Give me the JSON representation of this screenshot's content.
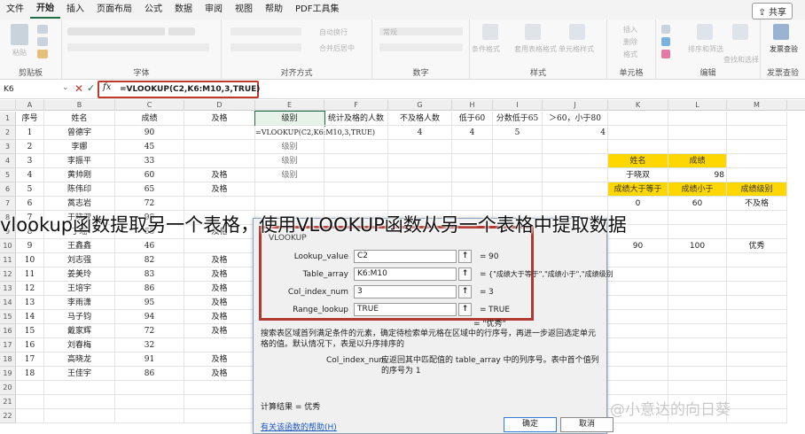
{
  "menu": {
    "items": [
      "文件",
      "开始",
      "插入",
      "页面布局",
      "公式",
      "数据",
      "审阅",
      "视图",
      "帮助",
      "PDF工具集"
    ],
    "active_index": 1,
    "share_label": "共享"
  },
  "ribbon": {
    "groups": [
      "剪贴板",
      "字体",
      "对齐方式",
      "数字",
      "样式",
      "单元格",
      "编辑",
      "发票查验"
    ],
    "paste_label": "粘贴",
    "wrap_text_label": "自动换行",
    "merge_label": "合并后居中",
    "number_format_label": "常规",
    "conditional_format_label": "条件格式",
    "table_format_label": "套用表格格式",
    "cell_style_label": "单元格样式",
    "insert_label": "插入",
    "delete_label": "删除",
    "format_label": "格式",
    "sort_filter_label": "排序和筛选",
    "find_select_label": "查找和选择",
    "invoice_label": "发票查验"
  },
  "formula_bar": {
    "name_box": "K6",
    "fx": "fx",
    "formula": "=VLOOKUP(C2,K6:M10,3,TRUE)"
  },
  "columns": [
    "A",
    "B",
    "C",
    "D",
    "E",
    "F",
    "G",
    "H",
    "I",
    "J",
    "K",
    "L",
    "M"
  ],
  "rows": [
    {
      "n": "1",
      "cells": [
        "序号",
        "姓名",
        "成绩",
        "及格",
        "级别",
        "统计及格的人数",
        "不及格人数",
        "低于60",
        "分数低于65",
        "＞60，小于80"
      ]
    },
    {
      "n": "2",
      "cells": [
        "1",
        "曾德宇",
        "90",
        "",
        "=VLOOKUP(C2,K6:M10,3,TRUE)",
        "",
        "4",
        "4",
        "5",
        "4"
      ]
    },
    {
      "n": "3",
      "cells": [
        "2",
        "李娜",
        "45",
        "",
        "级别",
        "",
        "",
        "",
        "",
        ""
      ]
    },
    {
      "n": "4",
      "cells": [
        "3",
        "李振平",
        "33",
        "",
        "级别",
        "",
        "",
        "",
        "",
        ""
      ]
    },
    {
      "n": "5",
      "cells": [
        "4",
        "黄帅刚",
        "60",
        "及格",
        "级别",
        "",
        "",
        "",
        "",
        ""
      ]
    },
    {
      "n": "6",
      "cells": [
        "5",
        "陈伟印",
        "65",
        "及格",
        "",
        "",
        "",
        "",
        "",
        ""
      ]
    },
    {
      "n": "7",
      "cells": [
        "6",
        "蒿志岩",
        "72",
        "",
        "",
        "",
        "",
        "",
        "",
        ""
      ]
    },
    {
      "n": "8",
      "cells": [
        "7",
        "于晓双",
        "98",
        "",
        "",
        "",
        "",
        "",
        "",
        ""
      ]
    },
    {
      "n": "9",
      "cells": [
        "8",
        "丁瑶",
        "65",
        "及格",
        "",
        "",
        "",
        "",
        "",
        ""
      ]
    },
    {
      "n": "10",
      "cells": [
        "9",
        "王鑫鑫",
        "46",
        "",
        "",
        "",
        "",
        "",
        "",
        ""
      ]
    },
    {
      "n": "11",
      "cells": [
        "10",
        "刘志强",
        "82",
        "及格",
        "",
        "",
        "",
        "",
        "",
        ""
      ]
    },
    {
      "n": "12",
      "cells": [
        "11",
        "姜美玲",
        "83",
        "及格",
        "",
        "",
        "",
        "",
        "",
        ""
      ]
    },
    {
      "n": "13",
      "cells": [
        "12",
        "王培宇",
        "86",
        "及格",
        "",
        "",
        "",
        "",
        "",
        ""
      ]
    },
    {
      "n": "14",
      "cells": [
        "13",
        "李雨潇",
        "95",
        "及格",
        "",
        "",
        "",
        "",
        "",
        ""
      ]
    },
    {
      "n": "15",
      "cells": [
        "14",
        "马子钧",
        "94",
        "及格",
        "",
        "",
        "",
        "",
        "",
        ""
      ]
    },
    {
      "n": "16",
      "cells": [
        "15",
        "戴家辉",
        "72",
        "及格",
        "",
        "",
        "",
        "",
        "",
        ""
      ]
    },
    {
      "n": "17",
      "cells": [
        "16",
        "刘春梅",
        "32",
        "",
        "",
        "",
        "",
        "",
        "",
        ""
      ]
    },
    {
      "n": "18",
      "cells": [
        "17",
        "高晓龙",
        "91",
        "及格",
        "",
        "",
        "",
        "",
        "",
        ""
      ]
    },
    {
      "n": "19",
      "cells": [
        "18",
        "王佳宇",
        "86",
        "及格",
        "",
        "",
        "",
        "",
        "",
        ""
      ]
    },
    {
      "n": "20",
      "cells": [
        "",
        "",
        "",
        "",
        "",
        "",
        "",
        "",
        "",
        ""
      ]
    },
    {
      "n": "21",
      "cells": [
        "",
        "",
        "",
        "",
        "",
        "",
        "",
        "",
        "",
        ""
      ]
    },
    {
      "n": "22",
      "cells": [
        "",
        "",
        "",
        "",
        "",
        "",
        "",
        "",
        "",
        ""
      ]
    }
  ],
  "lookup_table": {
    "row4": [
      "姓名",
      "成绩"
    ],
    "row5": [
      "于晓双",
      "98"
    ],
    "row6": [
      "成绩大于等于",
      "成绩小于",
      "成绩级别"
    ],
    "row7": [
      "0",
      "60",
      "不及格"
    ],
    "row9": [
      "90",
      "100",
      "优秀"
    ]
  },
  "dialog": {
    "title": "VLOOKUP",
    "args": [
      {
        "label": "Lookup_value",
        "value": "C2",
        "result": "90"
      },
      {
        "label": "Table_array",
        "value": "K6:M10",
        "result": "{\"成绩大于等于\",\"成绩小于\",\"成绩级别\""
      },
      {
        "label": "Col_index_num",
        "value": "3",
        "result": "3"
      },
      {
        "label": "Range_lookup",
        "value": "TRUE",
        "result": "TRUE"
      }
    ],
    "result_preview": "= \"优秀\"",
    "description": "搜索表区域首列满足条件的元素，确定待检索单元格在区域中的行序号，再进一步返回选定单元格的值。默认情况下，表是以升序排序的",
    "arg_name": "Col_index_num",
    "arg_description": "应返回其中匹配值的 table_array 中的列序号。表中首个值列的序号为 1",
    "calc_result": "计算结果 =  优秀",
    "help_link": "有关该函数的帮助(H)",
    "ok_label": "确定",
    "cancel_label": "取消"
  },
  "caption": "vlookup函数提取另一个表格，使用VLOOKUP函数从另一个表格中提取数据",
  "watermark": "@小意达的向日葵",
  "colors": {
    "accent": "#1e7145",
    "highlight_red": "#c0392b",
    "yellow": "#ffd700"
  }
}
